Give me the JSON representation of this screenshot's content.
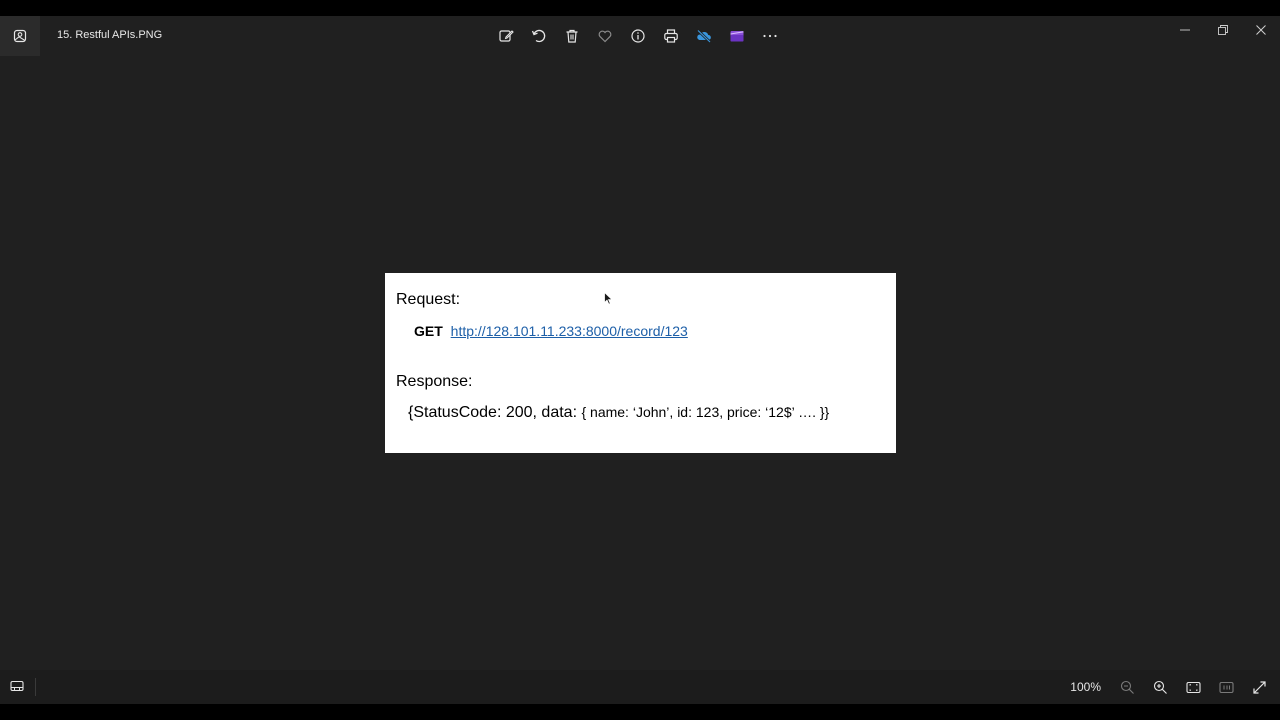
{
  "window": {
    "title": "15. Restful APIs.PNG"
  },
  "toolbar": {
    "items": [
      "edit-image-icon",
      "rotate-icon",
      "delete-icon",
      "favorite-icon",
      "info-icon",
      "print-icon",
      "onedrive-off-icon",
      "video-editor-icon",
      "more-icon"
    ]
  },
  "image": {
    "request_label": "Request:",
    "method": "GET",
    "url": "http://128.101.11.233:8000/record/123",
    "response_label": "Response:",
    "response_prefix": "{StatusCode: 200, data: ",
    "response_body": "{ name: ‘John’, id: 123, price: ‘12$’ …. }}"
  },
  "statusbar": {
    "zoom": "100%"
  },
  "colors": {
    "background": "#202020",
    "link": "#1d5fa8",
    "onedrive_blue": "#3a96dd",
    "clipchamp_purple": "#8a4fd8"
  }
}
